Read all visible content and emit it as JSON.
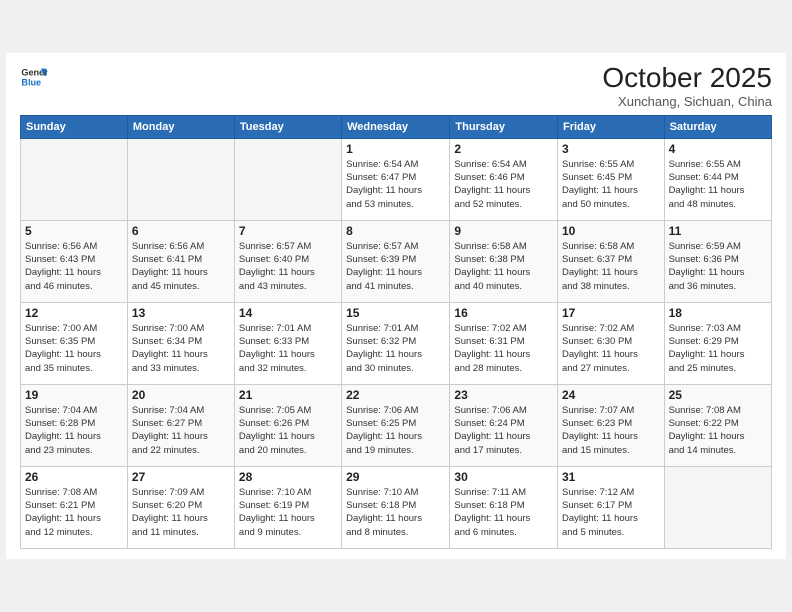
{
  "header": {
    "logo_line1": "General",
    "logo_line2": "Blue",
    "month": "October 2025",
    "location": "Xunchang, Sichuan, China"
  },
  "weekdays": [
    "Sunday",
    "Monday",
    "Tuesday",
    "Wednesday",
    "Thursday",
    "Friday",
    "Saturday"
  ],
  "weeks": [
    [
      {
        "day": "",
        "info": ""
      },
      {
        "day": "",
        "info": ""
      },
      {
        "day": "",
        "info": ""
      },
      {
        "day": "1",
        "info": "Sunrise: 6:54 AM\nSunset: 6:47 PM\nDaylight: 11 hours\nand 53 minutes."
      },
      {
        "day": "2",
        "info": "Sunrise: 6:54 AM\nSunset: 6:46 PM\nDaylight: 11 hours\nand 52 minutes."
      },
      {
        "day": "3",
        "info": "Sunrise: 6:55 AM\nSunset: 6:45 PM\nDaylight: 11 hours\nand 50 minutes."
      },
      {
        "day": "4",
        "info": "Sunrise: 6:55 AM\nSunset: 6:44 PM\nDaylight: 11 hours\nand 48 minutes."
      }
    ],
    [
      {
        "day": "5",
        "info": "Sunrise: 6:56 AM\nSunset: 6:43 PM\nDaylight: 11 hours\nand 46 minutes."
      },
      {
        "day": "6",
        "info": "Sunrise: 6:56 AM\nSunset: 6:41 PM\nDaylight: 11 hours\nand 45 minutes."
      },
      {
        "day": "7",
        "info": "Sunrise: 6:57 AM\nSunset: 6:40 PM\nDaylight: 11 hours\nand 43 minutes."
      },
      {
        "day": "8",
        "info": "Sunrise: 6:57 AM\nSunset: 6:39 PM\nDaylight: 11 hours\nand 41 minutes."
      },
      {
        "day": "9",
        "info": "Sunrise: 6:58 AM\nSunset: 6:38 PM\nDaylight: 11 hours\nand 40 minutes."
      },
      {
        "day": "10",
        "info": "Sunrise: 6:58 AM\nSunset: 6:37 PM\nDaylight: 11 hours\nand 38 minutes."
      },
      {
        "day": "11",
        "info": "Sunrise: 6:59 AM\nSunset: 6:36 PM\nDaylight: 11 hours\nand 36 minutes."
      }
    ],
    [
      {
        "day": "12",
        "info": "Sunrise: 7:00 AM\nSunset: 6:35 PM\nDaylight: 11 hours\nand 35 minutes."
      },
      {
        "day": "13",
        "info": "Sunrise: 7:00 AM\nSunset: 6:34 PM\nDaylight: 11 hours\nand 33 minutes."
      },
      {
        "day": "14",
        "info": "Sunrise: 7:01 AM\nSunset: 6:33 PM\nDaylight: 11 hours\nand 32 minutes."
      },
      {
        "day": "15",
        "info": "Sunrise: 7:01 AM\nSunset: 6:32 PM\nDaylight: 11 hours\nand 30 minutes."
      },
      {
        "day": "16",
        "info": "Sunrise: 7:02 AM\nSunset: 6:31 PM\nDaylight: 11 hours\nand 28 minutes."
      },
      {
        "day": "17",
        "info": "Sunrise: 7:02 AM\nSunset: 6:30 PM\nDaylight: 11 hours\nand 27 minutes."
      },
      {
        "day": "18",
        "info": "Sunrise: 7:03 AM\nSunset: 6:29 PM\nDaylight: 11 hours\nand 25 minutes."
      }
    ],
    [
      {
        "day": "19",
        "info": "Sunrise: 7:04 AM\nSunset: 6:28 PM\nDaylight: 11 hours\nand 23 minutes."
      },
      {
        "day": "20",
        "info": "Sunrise: 7:04 AM\nSunset: 6:27 PM\nDaylight: 11 hours\nand 22 minutes."
      },
      {
        "day": "21",
        "info": "Sunrise: 7:05 AM\nSunset: 6:26 PM\nDaylight: 11 hours\nand 20 minutes."
      },
      {
        "day": "22",
        "info": "Sunrise: 7:06 AM\nSunset: 6:25 PM\nDaylight: 11 hours\nand 19 minutes."
      },
      {
        "day": "23",
        "info": "Sunrise: 7:06 AM\nSunset: 6:24 PM\nDaylight: 11 hours\nand 17 minutes."
      },
      {
        "day": "24",
        "info": "Sunrise: 7:07 AM\nSunset: 6:23 PM\nDaylight: 11 hours\nand 15 minutes."
      },
      {
        "day": "25",
        "info": "Sunrise: 7:08 AM\nSunset: 6:22 PM\nDaylight: 11 hours\nand 14 minutes."
      }
    ],
    [
      {
        "day": "26",
        "info": "Sunrise: 7:08 AM\nSunset: 6:21 PM\nDaylight: 11 hours\nand 12 minutes."
      },
      {
        "day": "27",
        "info": "Sunrise: 7:09 AM\nSunset: 6:20 PM\nDaylight: 11 hours\nand 11 minutes."
      },
      {
        "day": "28",
        "info": "Sunrise: 7:10 AM\nSunset: 6:19 PM\nDaylight: 11 hours\nand 9 minutes."
      },
      {
        "day": "29",
        "info": "Sunrise: 7:10 AM\nSunset: 6:18 PM\nDaylight: 11 hours\nand 8 minutes."
      },
      {
        "day": "30",
        "info": "Sunrise: 7:11 AM\nSunset: 6:18 PM\nDaylight: 11 hours\nand 6 minutes."
      },
      {
        "day": "31",
        "info": "Sunrise: 7:12 AM\nSunset: 6:17 PM\nDaylight: 11 hours\nand 5 minutes."
      },
      {
        "day": "",
        "info": ""
      }
    ]
  ]
}
